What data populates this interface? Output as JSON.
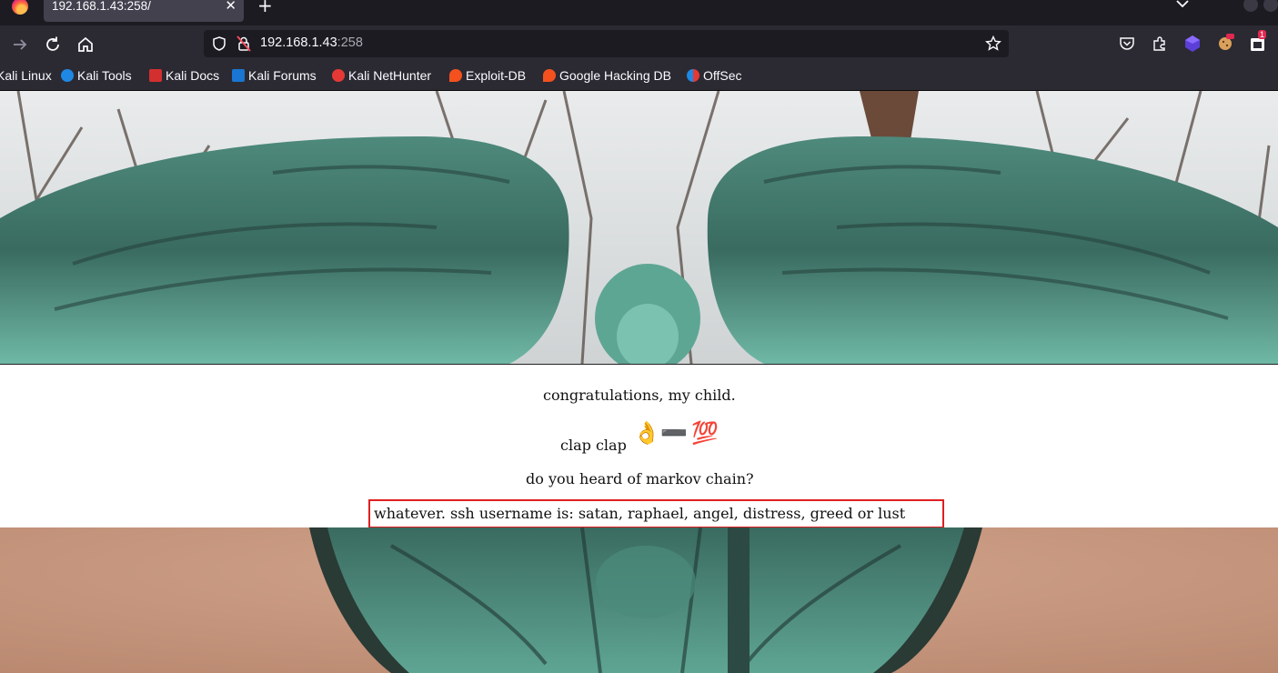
{
  "browser": {
    "tab": {
      "title": "192.168.1.43:258/"
    },
    "url": {
      "host": "192.168.1.43",
      "port": ":258"
    },
    "bookmarks": [
      {
        "label": "Kali Linux",
        "icon": "kali-icon",
        "color": "#367bf0"
      },
      {
        "label": "Kali Tools",
        "icon": "kali-tools-icon",
        "color": "#1f88e5"
      },
      {
        "label": "Kali Docs",
        "icon": "kali-docs-icon",
        "color": "#d32f2f"
      },
      {
        "label": "Kali Forums",
        "icon": "kali-forums-icon",
        "color": "#1976d2"
      },
      {
        "label": "Kali NetHunter",
        "icon": "nethunter-icon",
        "color": "#e53935"
      },
      {
        "label": "Exploit-DB",
        "icon": "exploit-db-icon",
        "color": "#f4511e"
      },
      {
        "label": "Google Hacking DB",
        "icon": "ghdb-icon",
        "color": "#f4511e"
      },
      {
        "label": "OffSec",
        "icon": "offsec-icon",
        "color": "#1e88e5"
      }
    ],
    "notification_badge": "1"
  },
  "page": {
    "lines": [
      "congratulations, my child.",
      "clap clap",
      "do you heard of markov chain?",
      "whatever. ssh username is: satan, raphael, angel, distress, greed or lust"
    ],
    "emoji": [
      "👌",
      "➖",
      "💯"
    ]
  }
}
